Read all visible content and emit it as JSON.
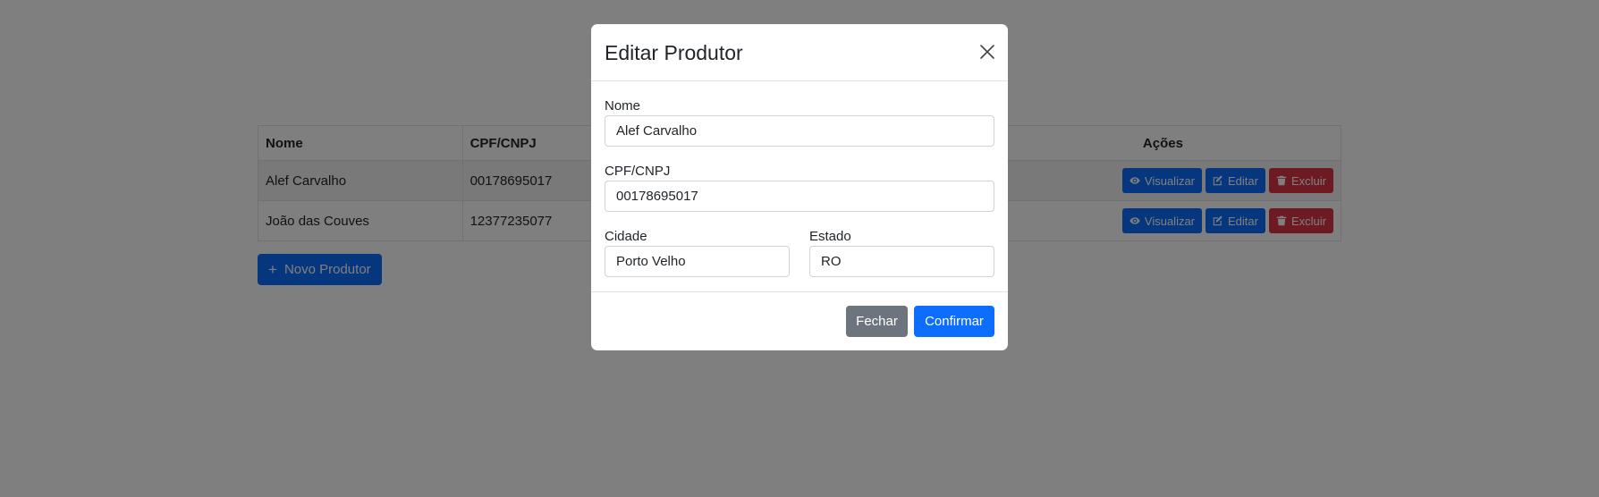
{
  "table": {
    "headers": {
      "nome": "Nome",
      "cpf_cnpj": "CPF/CNPJ",
      "acoes": "Ações"
    },
    "rows": [
      {
        "nome": "Alef Carvalho",
        "cpf_cnpj": "00178695017"
      },
      {
        "nome": "João das Couves",
        "cpf_cnpj": "12377235077"
      }
    ],
    "actions": {
      "visualizar": "Visualizar",
      "editar": "Editar",
      "excluir": "Excluir"
    }
  },
  "new_button": {
    "icon": "plus-icon",
    "label": "Novo Produtor"
  },
  "modal": {
    "title": "Editar Produtor",
    "close_icon": "close-icon",
    "fields": {
      "nome": {
        "label": "Nome",
        "value": "Alef Carvalho"
      },
      "cpf_cnpj": {
        "label": "CPF/CNPJ",
        "value": "00178695017"
      },
      "cidade": {
        "label": "Cidade",
        "value": "Porto Velho"
      },
      "estado": {
        "label": "Estado",
        "value": "RO"
      }
    },
    "buttons": {
      "fechar": "Fechar",
      "confirmar": "Confirmar"
    }
  },
  "colors": {
    "primary": "#0d6efd",
    "danger": "#dc3545",
    "secondary": "#6c757d",
    "backdrop": "rgba(0,0,0,0.5)"
  }
}
